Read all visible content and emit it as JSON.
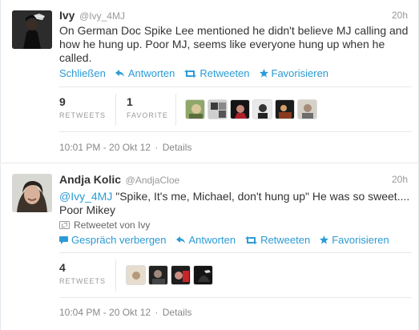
{
  "tweets": [
    {
      "name": "Ivy",
      "handle": "@Ivy_4MJ",
      "time": "20h",
      "text": "On German Doc Spike Lee mentioned he didn't believe MJ calling and how he hung up. Poor MJ, seems like everyone hung up when he called.",
      "actions": [
        "Schließen",
        "Antworten",
        "Retweeten",
        "Favorisieren"
      ],
      "retweets": "9",
      "retweets_label": "RETWEETS",
      "favorites": "1",
      "favorites_label": "FAVORITE",
      "timestamp": "10:01 PM - 20 Okt 12",
      "details": "Details"
    },
    {
      "name": "Andja Kolic",
      "handle": "@AndjaCloe",
      "time": "20h",
      "mention": "@Ivy_4MJ",
      "text": " \"Spike, It's me, Michael, don't hung up\" He was so sweet.... Poor Mikey",
      "retweeted_by": "Retweetet von Ivy",
      "actions": [
        "Gespräch verbergen",
        "Antworten",
        "Retweeten",
        "Favorisieren"
      ],
      "retweets": "4",
      "retweets_label": "RETWEETS",
      "timestamp": "10:04 PM - 20 Okt 12",
      "details": "Details"
    }
  ],
  "colors": {
    "link": "#2b9bd5",
    "muted": "#999999",
    "text": "#333333"
  },
  "icons": [
    "reply-icon",
    "retweet-icon",
    "favorite-star-icon",
    "conversation-icon"
  ]
}
